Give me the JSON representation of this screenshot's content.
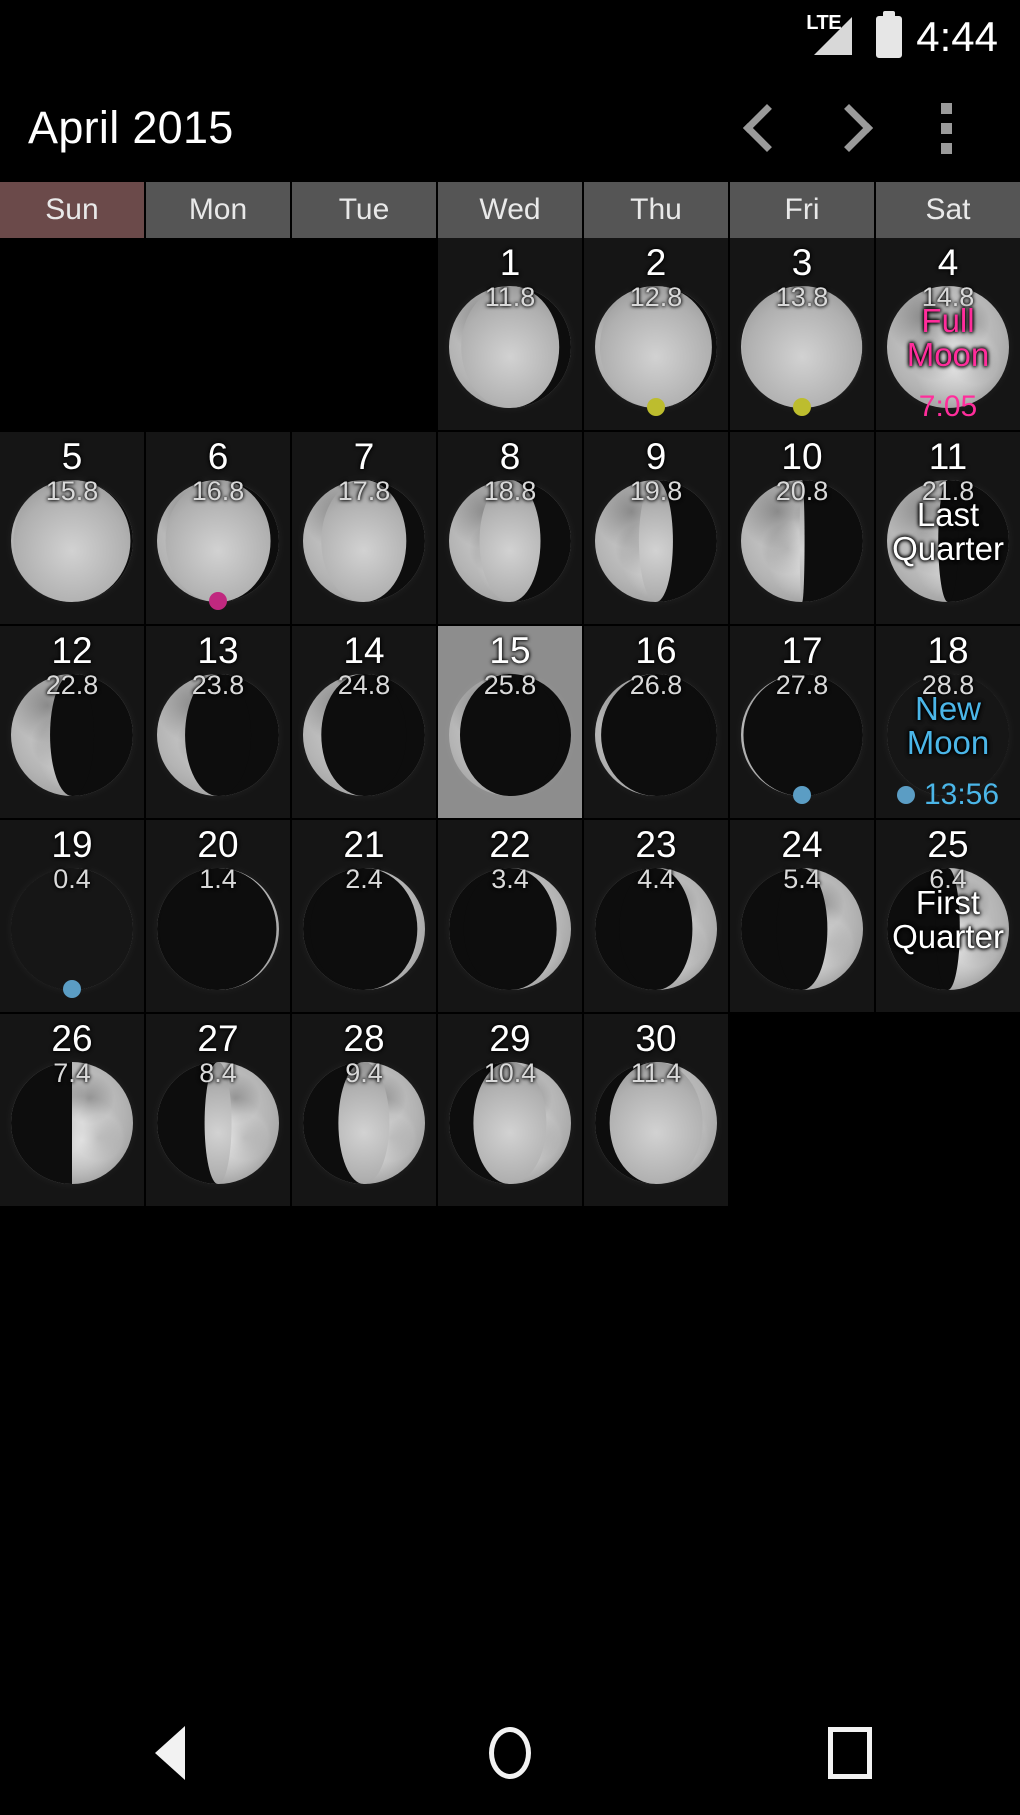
{
  "status_bar": {
    "network_label": "LTE",
    "time": "4:44",
    "signal_icon": "signal-triangle-icon",
    "battery_icon": "battery-full-icon"
  },
  "action_bar": {
    "title": "April 2015",
    "prev_label": "",
    "next_label": "",
    "overflow_label": ""
  },
  "weekdays": [
    {
      "label": "Sun",
      "highlight": true
    },
    {
      "label": "Mon",
      "highlight": false
    },
    {
      "label": "Tue",
      "highlight": false
    },
    {
      "label": "Wed",
      "highlight": false
    },
    {
      "label": "Thu",
      "highlight": false
    },
    {
      "label": "Fri",
      "highlight": false
    },
    {
      "label": "Sat",
      "highlight": false
    }
  ],
  "colors": {
    "full_moon": "#ff2d9b",
    "new_moon": "#4bb6e8",
    "quarter": "#ffffff",
    "dot_olive": "#bdbd2e",
    "dot_magenta": "#c0287f",
    "dot_blue": "#5b9dc4",
    "sunday_header": "#6b4a4a",
    "weekday_header": "#555555",
    "selected_cell": "#8d8d8d",
    "cell_background": "#151515"
  },
  "chart_data": {
    "type": "table",
    "title": "April 2015 Moon Phase Calendar",
    "columns": [
      "Sun",
      "Mon",
      "Tue",
      "Wed",
      "Thu",
      "Fri",
      "Sat"
    ],
    "weeks": [
      [
        {
          "blank": true
        },
        {
          "blank": true
        },
        {
          "blank": true
        },
        {
          "day": "1",
          "age": "11.8",
          "illum": 0.9,
          "waxing": false
        },
        {
          "day": "2",
          "age": "12.8",
          "illum": 0.96,
          "waxing": false,
          "dot": "olive"
        },
        {
          "day": "3",
          "age": "13.8",
          "illum": 0.99,
          "waxing": false,
          "dot": "olive"
        },
        {
          "day": "4",
          "age": "14.8",
          "illum": 1.0,
          "waxing": false,
          "phase": "Full\nMoon",
          "phase_type": "full",
          "time": "7:05"
        }
      ],
      [
        {
          "day": "5",
          "age": "15.8",
          "illum": 0.98,
          "waxing": false
        },
        {
          "day": "6",
          "age": "16.8",
          "illum": 0.93,
          "waxing": false,
          "dot": "magenta"
        },
        {
          "day": "7",
          "age": "17.8",
          "illum": 0.85,
          "waxing": false
        },
        {
          "day": "8",
          "age": "18.8",
          "illum": 0.75,
          "waxing": false
        },
        {
          "day": "9",
          "age": "19.8",
          "illum": 0.64,
          "waxing": false
        },
        {
          "day": "10",
          "age": "20.8",
          "illum": 0.52,
          "waxing": false
        },
        {
          "day": "11",
          "age": "21.8",
          "illum": 0.42,
          "waxing": false,
          "phase": "Last\nQuarter",
          "phase_type": "quarter"
        }
      ],
      [
        {
          "day": "12",
          "age": "22.8",
          "illum": 0.32,
          "waxing": false
        },
        {
          "day": "13",
          "age": "23.8",
          "illum": 0.23,
          "waxing": false
        },
        {
          "day": "14",
          "age": "24.8",
          "illum": 0.15,
          "waxing": false
        },
        {
          "day": "15",
          "age": "25.8",
          "illum": 0.09,
          "waxing": false,
          "selected": true
        },
        {
          "day": "16",
          "age": "26.8",
          "illum": 0.05,
          "waxing": false
        },
        {
          "day": "17",
          "age": "27.8",
          "illum": 0.02,
          "waxing": false,
          "dot": "blue"
        },
        {
          "day": "18",
          "age": "28.8",
          "illum": 0.0,
          "waxing": false,
          "phase": "New\nMoon",
          "phase_type": "new",
          "time": "13:56",
          "dot": "blue"
        }
      ],
      [
        {
          "day": "19",
          "age": "0.4",
          "illum": 0.0,
          "waxing": true,
          "dot": "blue"
        },
        {
          "day": "20",
          "age": "1.4",
          "illum": 0.02,
          "waxing": true
        },
        {
          "day": "21",
          "age": "2.4",
          "illum": 0.06,
          "waxing": true
        },
        {
          "day": "22",
          "age": "3.4",
          "illum": 0.12,
          "waxing": true
        },
        {
          "day": "23",
          "age": "4.4",
          "illum": 0.2,
          "waxing": true
        },
        {
          "day": "24",
          "age": "5.4",
          "illum": 0.29,
          "waxing": true
        },
        {
          "day": "25",
          "age": "6.4",
          "illum": 0.4,
          "waxing": true,
          "phase": "First\nQuarter",
          "phase_type": "quarter"
        }
      ],
      [
        {
          "day": "26",
          "age": "7.4",
          "illum": 0.5,
          "waxing": true
        },
        {
          "day": "27",
          "age": "8.4",
          "illum": 0.61,
          "waxing": true
        },
        {
          "day": "28",
          "age": "9.4",
          "illum": 0.71,
          "waxing": true
        },
        {
          "day": "29",
          "age": "10.4",
          "illum": 0.8,
          "waxing": true
        },
        {
          "day": "30",
          "age": "11.4",
          "illum": 0.88,
          "waxing": true
        },
        {
          "blank": true
        },
        {
          "blank": true
        }
      ]
    ]
  },
  "nav_bar": {
    "back_icon": "back-triangle-icon",
    "home_icon": "home-circle-icon",
    "recents_icon": "recents-square-icon"
  }
}
